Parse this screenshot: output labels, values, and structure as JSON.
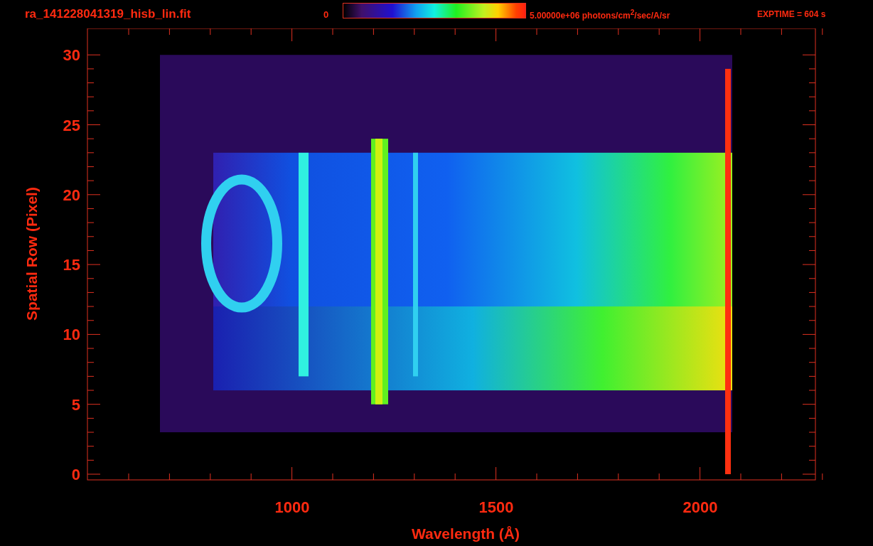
{
  "title": "ra_141228041319_hisb_lin.fit",
  "colorbar": {
    "min_label": "0",
    "max_label": "5.00000e+06 photons/cm$^{2}$/sec/A/sr"
  },
  "exposure": "EXPTIME = 604 s",
  "plot": {
    "ylabel": "Spatial Row (Pixel)",
    "xlabel": "Wavelength (Å)",
    "yticks": [
      "30",
      "25",
      "20",
      "15",
      "10",
      "5",
      "0"
    ],
    "xticks": [
      "1000",
      "1500",
      "2000"
    ]
  }
}
